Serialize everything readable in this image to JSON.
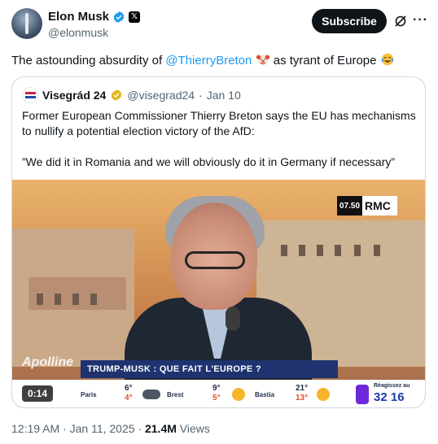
{
  "author": {
    "display_name": "Elon Musk",
    "handle": "@elonmusk"
  },
  "actions": {
    "subscribe_label": "Subscribe"
  },
  "tweet": {
    "text_before": "The astounding absurdity of ",
    "mention": "@ThierryBreton",
    "text_middle": " as tyrant of Europe "
  },
  "quote": {
    "name": "Visegrád 24",
    "handle": "@visegrad24",
    "date": "Jan 10",
    "separator": "·",
    "paragraph1": "Former European Commissioner Thierry Breton says the EU has mechanisms to nullify a potential election victory of the AfD:",
    "paragraph2": "”We did it in Romania and we will obviously do it in Germany if necessary”"
  },
  "video": {
    "duration": "0:14",
    "channel_time": "07.50",
    "channel_name": "RMC",
    "channel_tag": "Apolline",
    "headline": "TRUMP-MUSK : QUE FAIT L'EUROPE ?",
    "weather": [
      {
        "city": "Paris",
        "high": "6°",
        "low": "4°"
      },
      {
        "city": "Brest",
        "high": "9°",
        "low": "5°"
      },
      {
        "city": "Bastia",
        "high": "21°",
        "low": "13°"
      }
    ],
    "promo_label": "Réagissez au",
    "promo_number": "32 16"
  },
  "footer": {
    "time": "12:19 AM",
    "date": "Jan 11, 2025",
    "separator": "·",
    "views_count": "21.4M",
    "views_label": "Views"
  }
}
